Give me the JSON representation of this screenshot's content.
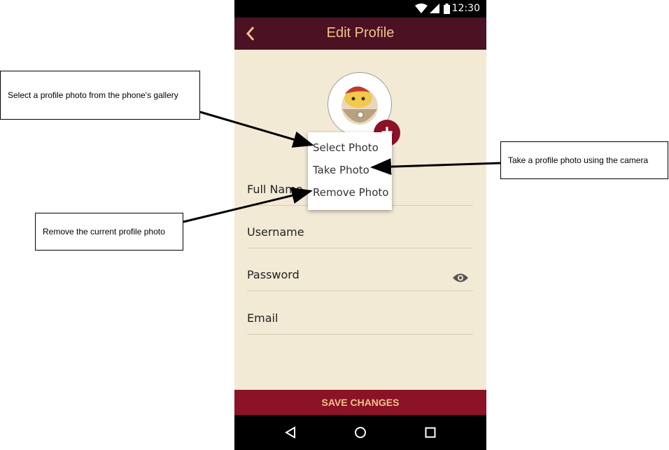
{
  "status_bar": {
    "time": "12:30"
  },
  "app_bar": {
    "title": "Edit Profile"
  },
  "form": {
    "fields": [
      {
        "label": "Full Name"
      },
      {
        "label": "Username"
      },
      {
        "label": "Password"
      },
      {
        "label": "Email"
      }
    ]
  },
  "photo_menu": {
    "items": [
      "Select Photo",
      "Take Photo",
      "Remove Photo"
    ]
  },
  "save_label": "SAVE CHANGES",
  "annotations": {
    "select": "Select a profile photo from the phone's gallery",
    "take": "Take a profile photo using the camera",
    "remove": "Remove the current profile photo"
  },
  "colors": {
    "app_bar": "#4a1222",
    "accent": "#8c1228",
    "title_text": "#f0c48a",
    "background": "#f3ead6"
  }
}
